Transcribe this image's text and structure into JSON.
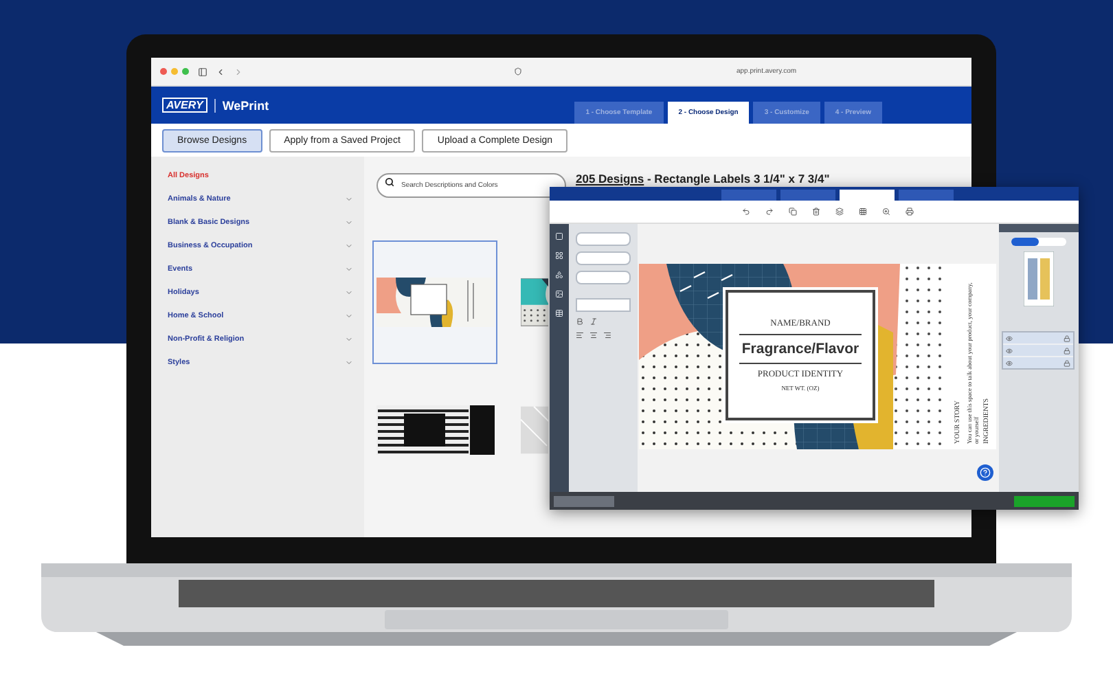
{
  "browser": {
    "url": "app.print.avery.com"
  },
  "header": {
    "logo": "AVERY",
    "product": "WePrint",
    "steps": [
      {
        "label": "1 - Choose Template",
        "selected": false
      },
      {
        "label": "2 - Choose Design",
        "selected": true
      },
      {
        "label": "3 - Customize",
        "selected": false
      },
      {
        "label": "4 - Preview",
        "selected": false
      }
    ]
  },
  "modes": [
    {
      "label": "Browse Designs",
      "selected": true
    },
    {
      "label": "Apply from a Saved Project",
      "selected": false
    },
    {
      "label": "Upload a Complete Design",
      "selected": false
    }
  ],
  "sidebar": {
    "items": [
      {
        "label": "All Designs",
        "selected": true,
        "expandable": false
      },
      {
        "label": "Animals & Nature",
        "selected": false,
        "expandable": true
      },
      {
        "label": "Blank & Basic Designs",
        "selected": false,
        "expandable": true
      },
      {
        "label": "Business & Occupation",
        "selected": false,
        "expandable": true
      },
      {
        "label": "Events",
        "selected": false,
        "expandable": true
      },
      {
        "label": "Holidays",
        "selected": false,
        "expandable": true
      },
      {
        "label": "Home & School",
        "selected": false,
        "expandable": true
      },
      {
        "label": "Non-Profit & Religion",
        "selected": false,
        "expandable": true
      },
      {
        "label": "Styles",
        "selected": false,
        "expandable": true
      }
    ]
  },
  "search": {
    "placeholder": "Search Descriptions and Colors"
  },
  "results": {
    "count": "205 Designs",
    "description": " - Rectangle Labels 3 1/4\" x 7 3/4\""
  },
  "designs": [
    {
      "kind": "abstract",
      "selected": true
    },
    {
      "kind": "teal",
      "selected": false
    },
    {
      "kind": "black",
      "selected": false
    },
    {
      "kind": "gray",
      "selected": false
    }
  ],
  "editor": {
    "steps": [
      {
        "selected": false
      },
      {
        "selected": false
      },
      {
        "selected": true
      },
      {
        "selected": false
      }
    ],
    "label": {
      "brand": "NAME/BRAND",
      "title": "Fragrance/Flavor",
      "identity": "PRODUCT IDENTITY",
      "weight": "NET WT. (OZ)",
      "story_title": "YOUR STORY",
      "story": "You can use this space to talk about your product, your company, or yourself",
      "ingredients_title": "INGREDIENTS"
    }
  }
}
